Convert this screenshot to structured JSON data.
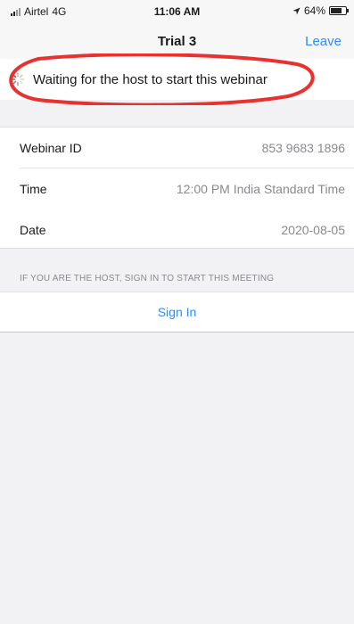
{
  "status_bar": {
    "carrier": "Airtel",
    "network": "4G",
    "time": "11:06 AM",
    "battery_text": "64%",
    "battery_level": 0.64,
    "signal_icon": "cellular-signal-icon",
    "location_icon": "location-arrow-icon"
  },
  "nav": {
    "title": "Trial 3",
    "leave_label": "Leave"
  },
  "banner": {
    "message": "Waiting for the host to start this webinar",
    "spinner_icon": "loading-spinner-icon",
    "highlight_color": "#e8322f"
  },
  "details": {
    "rows": [
      {
        "label": "Webinar ID",
        "value": "853 9683 1896"
      },
      {
        "label": "Time",
        "value": "12:00 PM India Standard Time"
      },
      {
        "label": "Date",
        "value": "2020-08-05"
      }
    ]
  },
  "host_section": {
    "header": "IF YOU ARE THE HOST, SIGN IN TO START THIS MEETING",
    "signin_label": "Sign In"
  },
  "colors": {
    "accent": "#2d8cff",
    "background": "#f2f2f4",
    "secondary_text": "#8a8a8e"
  }
}
